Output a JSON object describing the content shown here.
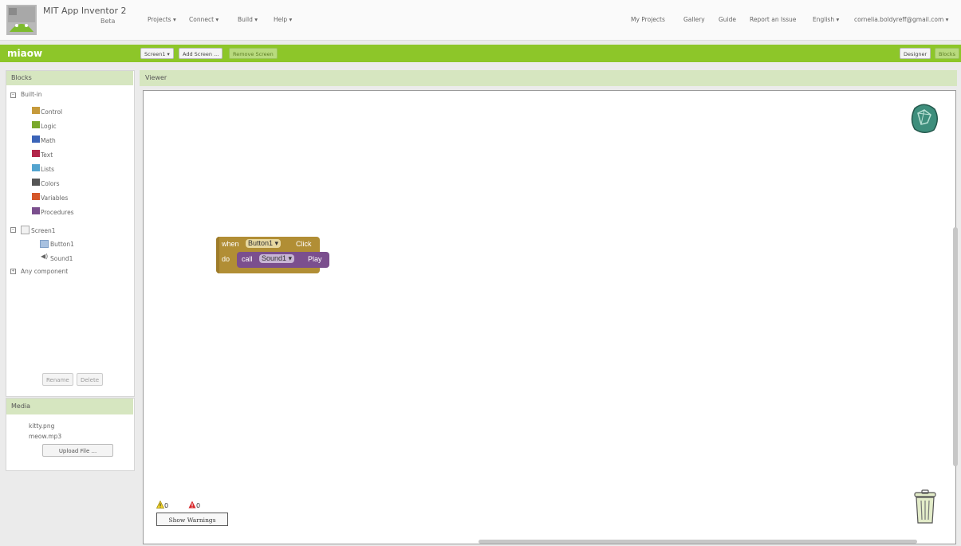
{
  "app": {
    "title": "MIT App Inventor 2",
    "beta": "Beta"
  },
  "topnav": {
    "left": [
      "Projects ▾",
      "Connect ▾",
      "Build ▾",
      "Help ▾"
    ],
    "right": [
      "My Projects",
      "Gallery",
      "Guide",
      "Report an Issue",
      "English ▾",
      "cornelia.boldyreff@gmail.com ▾"
    ]
  },
  "project": {
    "name": "miaow",
    "screen_dropdown": "Screen1 ▾",
    "add_screen": "Add Screen ...",
    "remove_screen": "Remove Screen",
    "designer": "Designer",
    "blocks": "Blocks"
  },
  "blocks_panel": {
    "title": "Blocks",
    "builtin_label": "Built-in",
    "builtin": [
      {
        "label": "Control",
        "color": "#c69a3b"
      },
      {
        "label": "Logic",
        "color": "#7aa92b"
      },
      {
        "label": "Math",
        "color": "#3b64b8"
      },
      {
        "label": "Text",
        "color": "#b2264a"
      },
      {
        "label": "Lists",
        "color": "#53a4cf"
      },
      {
        "label": "Colors",
        "color": "#555555"
      },
      {
        "label": "Variables",
        "color": "#d5572a"
      },
      {
        "label": "Procedures",
        "color": "#7b4f8e"
      }
    ],
    "screen_label": "Screen1",
    "components": [
      "Button1",
      "Sound1"
    ],
    "any_component": "Any component",
    "rename": "Rename",
    "delete": "Delete"
  },
  "media_panel": {
    "title": "Media",
    "files": [
      "kitty.png",
      "meow.mp3"
    ],
    "upload": "Upload File ..."
  },
  "viewer": {
    "title": "Viewer",
    "event_block": {
      "when": "when",
      "component": "Button1",
      "event": "Click",
      "do": "do",
      "call": "call",
      "call_component": "Sound1",
      "method": "Play"
    },
    "warnings_count": "0",
    "errors_count": "0",
    "show_warnings": "Show Warnings"
  },
  "colors": {
    "brand_green": "#8dc629",
    "event_block": "#b18e35",
    "method_block": "#7b4f8e"
  }
}
